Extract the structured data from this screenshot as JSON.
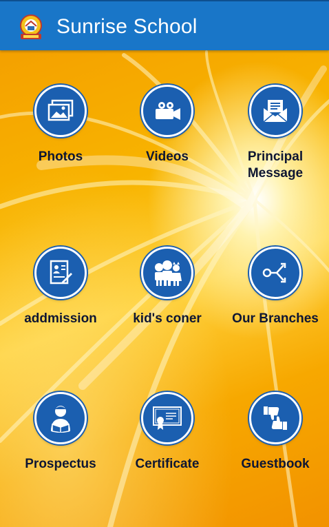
{
  "app_bar": {
    "title": "Sunrise School",
    "logo_icon": "school-crest-logo"
  },
  "colors": {
    "app_bar": "#1976c8",
    "icon_circle": "#1b5fb0",
    "label_text": "#0e1633",
    "background": "#f8b400"
  },
  "menu": [
    {
      "label": "Photos",
      "icon": "photo-icon"
    },
    {
      "label": "Videos",
      "icon": "video-camera-icon"
    },
    {
      "label": "Principal Message",
      "icon": "envelope-icon"
    },
    {
      "label": "addmission",
      "icon": "admission-form-icon"
    },
    {
      "label": "kid's coner",
      "icon": "kids-icon"
    },
    {
      "label": "Our Branches",
      "icon": "share-branches-icon"
    },
    {
      "label": "Prospectus",
      "icon": "reading-person-icon"
    },
    {
      "label": "Certificate",
      "icon": "certificate-icon"
    },
    {
      "label": "Guestbook",
      "icon": "thumbs-up-down-icon"
    }
  ]
}
